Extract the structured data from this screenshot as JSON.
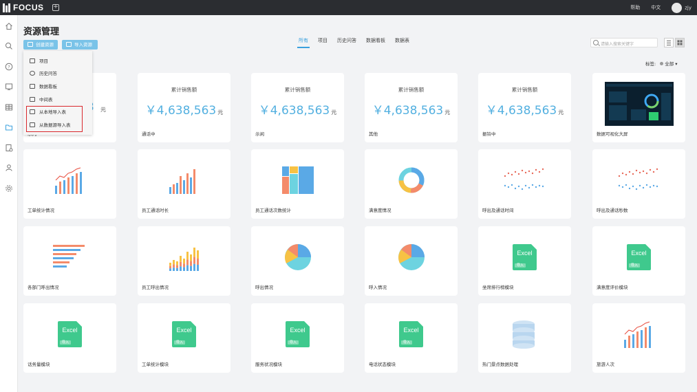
{
  "app": {
    "logo_text": "FOCUS",
    "help": "帮助",
    "language": "中文",
    "user": "zjy"
  },
  "page": {
    "title": "资源管理"
  },
  "toolbar": {
    "create_label": "创建资源",
    "import_label": "导入资源"
  },
  "dropdown": {
    "items": [
      {
        "label": "项目",
        "icon": "folder-icon"
      },
      {
        "label": "历史问答",
        "icon": "question-icon"
      },
      {
        "label": "数据看板",
        "icon": "dashboard-icon"
      },
      {
        "label": "中间表",
        "icon": "table-icon"
      },
      {
        "label": "从本地导入表",
        "icon": "table-icon"
      },
      {
        "label": "从数据源导入表",
        "icon": "table-icon"
      }
    ],
    "highlight_color": "#d9262c"
  },
  "tabs": [
    {
      "label": "所有",
      "active": true
    },
    {
      "label": "项目",
      "active": false
    },
    {
      "label": "历史问答",
      "active": false
    },
    {
      "label": "数据看板",
      "active": false
    },
    {
      "label": "数据表",
      "active": false
    }
  ],
  "search": {
    "placeholder": "请输入搜索关键字"
  },
  "filter": {
    "label": "标签:",
    "value": "全部"
  },
  "accent_color": "#3aa0dd",
  "cards": [
    {
      "type": "kpi",
      "kpi_title": "累计销售额",
      "kpi_value": "￥4,638,563",
      "kpi_unit": "元",
      "label": "示闪",
      "partial_value": "3"
    },
    {
      "type": "kpi",
      "kpi_title": "累计销售额",
      "kpi_value": "￥4,638,563",
      "kpi_unit": "元",
      "label": "通话中"
    },
    {
      "type": "kpi",
      "kpi_title": "累计销售额",
      "kpi_value": "￥4,638,563",
      "kpi_unit": "元",
      "label": "示闲"
    },
    {
      "type": "kpi",
      "kpi_title": "累计销售额",
      "kpi_value": "￥4,638,563",
      "kpi_unit": "元",
      "label": "其他"
    },
    {
      "type": "kpi",
      "kpi_title": "累计销售额",
      "kpi_value": "￥4,638,563",
      "kpi_unit": "元",
      "label": "振铃中"
    },
    {
      "type": "screen",
      "label": "数据可视化大屏"
    },
    {
      "type": "bar-line",
      "label": "工单统计情况"
    },
    {
      "type": "bar",
      "label": "员工通话时长"
    },
    {
      "type": "treemap",
      "label": "员工通话次数统计"
    },
    {
      "type": "donut",
      "label": "满意度情况"
    },
    {
      "type": "dots",
      "label": "呼出及通话时间"
    },
    {
      "type": "dots",
      "label": "呼出及通话秒数"
    },
    {
      "type": "hbar",
      "label": "各部门呼出情况"
    },
    {
      "type": "stacked",
      "label": "员工呼出情况"
    },
    {
      "type": "pie",
      "label": "呼出情况"
    },
    {
      "type": "pie",
      "label": "呼入情况"
    },
    {
      "type": "excel",
      "excel_text": "Excel",
      "excel_tag": "导入",
      "label": "坐席排行榜模块"
    },
    {
      "type": "excel",
      "excel_text": "Excel",
      "excel_tag": "导入",
      "label": "满意度评价模块"
    },
    {
      "type": "excel",
      "excel_text": "Excel",
      "excel_tag": "导入",
      "label": "话务量模块"
    },
    {
      "type": "excel",
      "excel_text": "Excel",
      "excel_tag": "导入",
      "label": "工单统计模块"
    },
    {
      "type": "excel",
      "excel_text": "Excel",
      "excel_tag": "导入",
      "label": "服务状况模块"
    },
    {
      "type": "excel",
      "excel_text": "Excel",
      "excel_tag": "导入",
      "label": "电话状态模块"
    },
    {
      "type": "db",
      "label": "热门景点数据处理"
    },
    {
      "type": "bar-line",
      "label": "旅游人次"
    }
  ]
}
